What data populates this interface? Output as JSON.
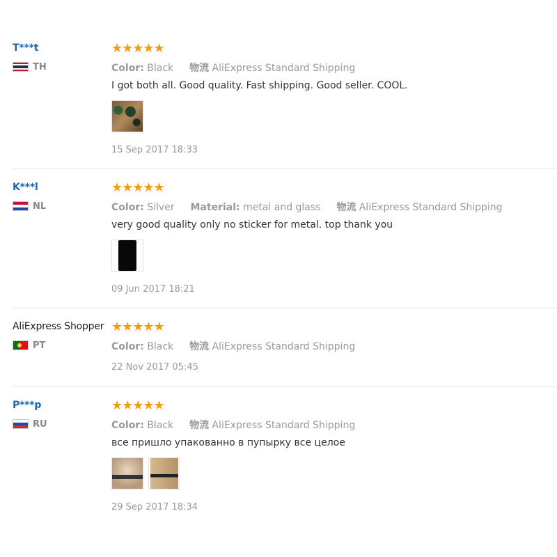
{
  "reviews": [
    {
      "user": "T***t",
      "country": "TH",
      "rating_stars": "★★★★★",
      "rating": 5,
      "attrs": [
        {
          "key": "Color:",
          "value": "Black"
        },
        {
          "key": "物流",
          "value": "AliExpress Standard Shipping"
        }
      ],
      "text": "I got both all. Good quality. Fast shipping. Good seller. COOL.",
      "photos": [
        "nails-photo"
      ],
      "date": "15 Sep 2017 18:33"
    },
    {
      "user": "K***l",
      "country": "NL",
      "rating_stars": "★★★★★",
      "rating": 5,
      "attrs": [
        {
          "key": "Color:",
          "value": "Silver"
        },
        {
          "key": "Material:",
          "value": "metal and glass"
        },
        {
          "key": "物流",
          "value": "AliExpress Standard Shipping"
        }
      ],
      "text": "very good quality only no sticker for metal. top thank you",
      "photos": [
        "phone-photo"
      ],
      "date": "09 Jun 2017 18:21"
    },
    {
      "user": "AliExpress Shopper",
      "country": "PT",
      "rating_stars": "★★★★★",
      "rating": 5,
      "attrs": [
        {
          "key": "Color:",
          "value": "Black"
        },
        {
          "key": "物流",
          "value": "AliExpress Standard Shipping"
        }
      ],
      "text": "",
      "photos": [],
      "date": "22 Nov 2017 05:45"
    },
    {
      "user": "P***p",
      "country": "RU",
      "rating_stars": "★★★★★",
      "rating": 5,
      "attrs": [
        {
          "key": "Color:",
          "value": "Black"
        },
        {
          "key": "物流",
          "value": "AliExpress Standard Shipping"
        }
      ],
      "text": "все пришло упакованно в пупырку все целое",
      "photos": [
        "package-photo-1",
        "package-photo-2"
      ],
      "date": "29 Sep 2017 18:34"
    }
  ],
  "colors": {
    "username": "#1a67b8",
    "stars": "#f39c12",
    "muted": "#999999",
    "divider": "#e6e6e6"
  }
}
